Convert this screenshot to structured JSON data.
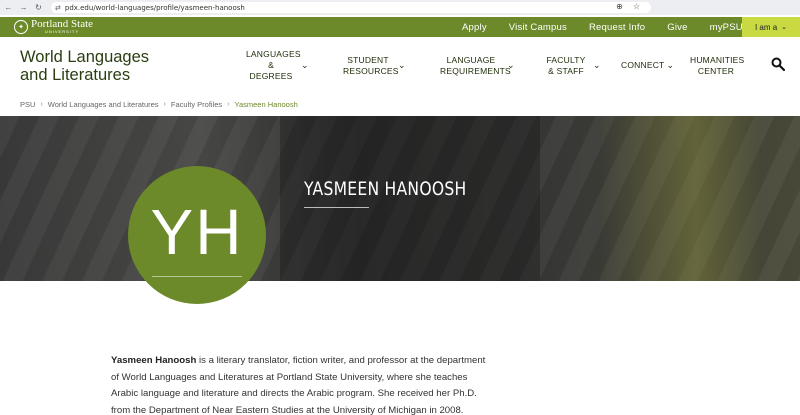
{
  "browser": {
    "url": "pdx.edu/world-languages/profile/yasmeen-hanoosh",
    "back_glyph": "←",
    "forward_glyph": "→",
    "reload_glyph": "↻",
    "site_glyph": "⇄",
    "zoom_glyph": "⊕",
    "star_glyph": "☆"
  },
  "utility": {
    "logo_name": "Portland State",
    "logo_sub": "UNIVERSITY",
    "links": [
      "Apply",
      "Visit Campus",
      "Request Info",
      "Give",
      "myPSU"
    ],
    "iam_label": "I am a",
    "chevron": "⌄"
  },
  "nav": {
    "site_title": "World Languages and Literatures",
    "items": [
      {
        "label": "Languages & Degrees"
      },
      {
        "label": "Student Resources"
      },
      {
        "label": "Language Requirements"
      },
      {
        "label": "Faculty & Staff"
      },
      {
        "label": "Connect"
      },
      {
        "label": "Humanities Center"
      }
    ],
    "chevron": "⌄"
  },
  "breadcrumb": {
    "items": [
      "PSU",
      "World Languages and Literatures",
      "Faculty Profiles"
    ],
    "current": "Yasmeen Hanoosh",
    "separator": "›"
  },
  "profile": {
    "name": "Yasmeen Hanoosh",
    "initials": "YH",
    "bio_name": "Yasmeen Hanoosh",
    "bio_text": " is a literary translator, fiction writer, and professor at the department of World Languages and Literatures at Portland State University, where she teaches Arabic language and literature and directs the Arabic program. She received her Ph.D. from the Department of Near Eastern Studies at the University of Michigan in 2008."
  },
  "colors": {
    "brand_green": "#6d8a2a",
    "accent_yellow": "#c9d942",
    "title_green": "#2a3e12"
  }
}
